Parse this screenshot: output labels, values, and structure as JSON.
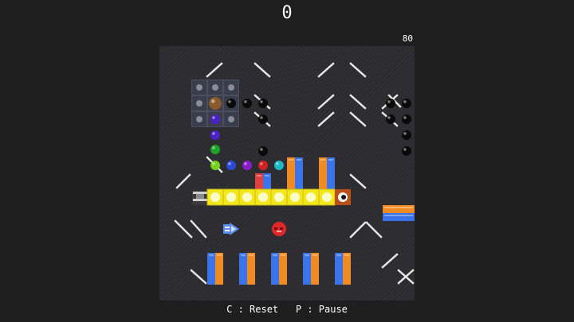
{
  "hud": {
    "score": "0",
    "timer": "80"
  },
  "controls": {
    "reset_key": "C",
    "reset_label": "Reset",
    "pause_key": "P",
    "pause_label": "Pause"
  },
  "colors": {
    "background": "#1e1e1e",
    "board": "#2c2c30",
    "deflector": "#e8e8e8",
    "block_orange": "#f08a24",
    "block_blue": "#3a74e8",
    "conveyor": "#f4e61c",
    "ball_black": "#0a0a0a",
    "ball_red": "#e0282a"
  },
  "entities": {
    "dispenser_icon": "dispenser-grid-icon",
    "emitter_icon": "ball-emitter-icon",
    "enemy_icon": "red-bomb-icon",
    "arrow_icon": "blue-arrow-icon",
    "pusher_icon": "pusher-icon"
  }
}
